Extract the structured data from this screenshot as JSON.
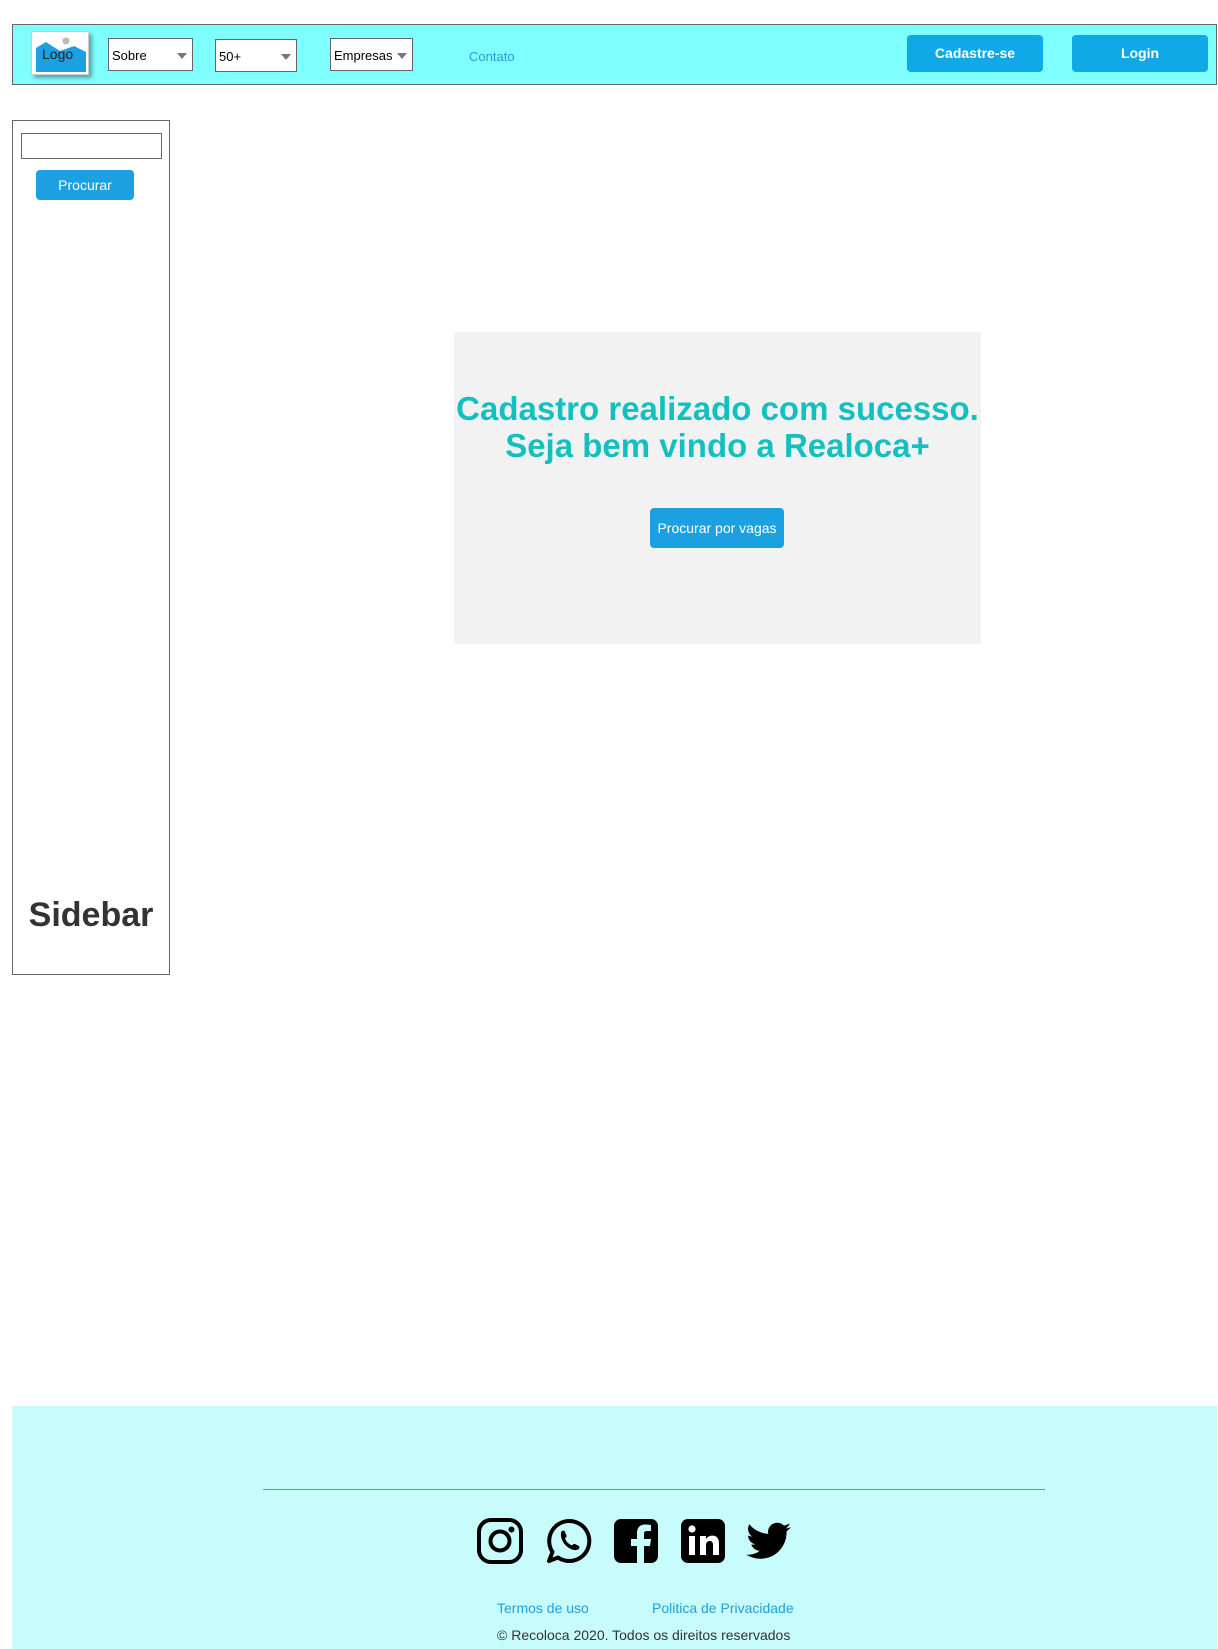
{
  "header": {
    "logo_label": "Logo",
    "menus": [
      {
        "label": "Sobre"
      },
      {
        "label": "50+"
      },
      {
        "label": "Empresas"
      }
    ],
    "contact_link": "Contato",
    "signup_button": "Cadastre-se",
    "login_button": "Login"
  },
  "sidebar": {
    "search_placeholder": "",
    "search_button": "Procurar",
    "title": "Sidebar"
  },
  "main": {
    "success_line1": "Cadastro realizado com sucesso.",
    "success_line2": "Seja bem vindo a Realoca+",
    "jobs_button": "Procurar por vagas"
  },
  "footer": {
    "social_icons": [
      "instagram-icon",
      "whatsapp-icon",
      "facebook-icon",
      "linkedin-icon",
      "twitter-icon"
    ],
    "terms_link": "Termos de uso",
    "privacy_link": "Politica de Privacidade",
    "copyright": "© Recoloca 2020. Todos os direitos reservados"
  },
  "colors": {
    "header_bg": "#80FFFF",
    "footer_bg": "#C8FBFB",
    "primary_button": "#1BA1E2",
    "success_text": "#12C0C0",
    "panel_bg": "#F2F2F2"
  }
}
